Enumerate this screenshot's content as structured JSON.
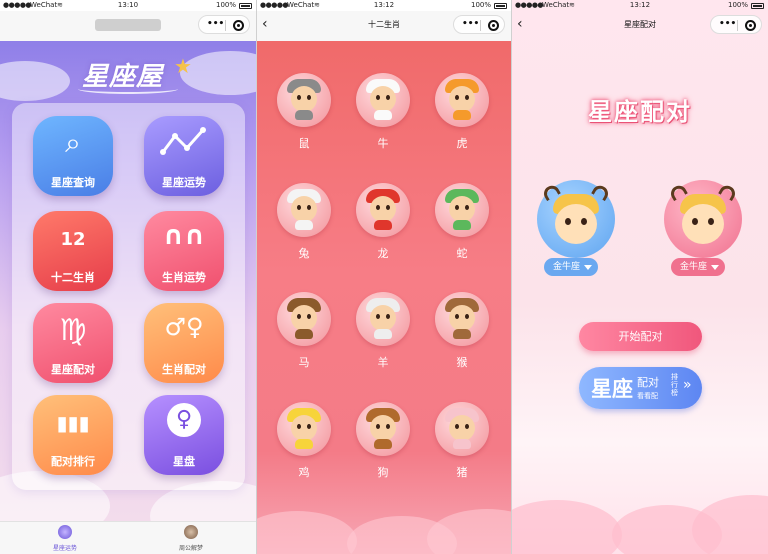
{
  "status": {
    "signal": "●●●●●",
    "carrier": "WeChat",
    "battery": "100%",
    "time1": "13:10",
    "time2": "13:12",
    "time3": "13:12"
  },
  "screen1": {
    "logo_text": "星座屋",
    "tiles": [
      {
        "label": "星座查询",
        "icon": "search-icon",
        "glyph": "⌕"
      },
      {
        "label": "星座运势",
        "icon": "trend-icon",
        "glyph": "⌇"
      },
      {
        "label": "十二生肖",
        "icon": "rabbit-icon",
        "glyph": "12"
      },
      {
        "label": "生肖运势",
        "icon": "rabbit-icon",
        "glyph": "∩∩"
      },
      {
        "label": "星座配对",
        "icon": "virgo-icon",
        "glyph": "♍"
      },
      {
        "label": "生肖配对",
        "icon": "gender-icon",
        "glyph": "♂♀"
      },
      {
        "label": "配对排行",
        "icon": "bar-chart-icon",
        "glyph": "▮▮▮"
      },
      {
        "label": "星盘",
        "icon": "venus-icon",
        "glyph": "♀"
      }
    ],
    "tabs": [
      {
        "label": "星座运势",
        "active": true
      },
      {
        "label": "周公解梦",
        "active": false
      }
    ]
  },
  "screen2": {
    "title": "十二生肖",
    "animals": [
      {
        "label": "鼠",
        "hat": "#8a8a8a"
      },
      {
        "label": "牛",
        "hat": "#fafafa"
      },
      {
        "label": "虎",
        "hat": "#f59a2b"
      },
      {
        "label": "兔",
        "hat": "#f4f4f4"
      },
      {
        "label": "龙",
        "hat": "#e0362c"
      },
      {
        "label": "蛇",
        "hat": "#5cb85c"
      },
      {
        "label": "马",
        "hat": "#8b5a2b"
      },
      {
        "label": "羊",
        "hat": "#eeeeee"
      },
      {
        "label": "猴",
        "hat": "#a0693a"
      },
      {
        "label": "鸡",
        "hat": "#f7d43a"
      },
      {
        "label": "狗",
        "hat": "#b06a2c"
      },
      {
        "label": "猪",
        "hat": "#f7c4cc"
      }
    ]
  },
  "screen3": {
    "title": "星座配对",
    "heading": "星座配对",
    "left_sign": "金牛座",
    "right_sign": "金牛座",
    "start_button": "开始配对",
    "rank_button": {
      "big": "星座",
      "mid": "配对",
      "small": "看看配",
      "vertical": "排行榜",
      "chevron": "»"
    }
  },
  "colors": {
    "accent_purple": "#6a55d8",
    "pink_button": "#f0577c",
    "blue_button": "#5d86f2"
  }
}
